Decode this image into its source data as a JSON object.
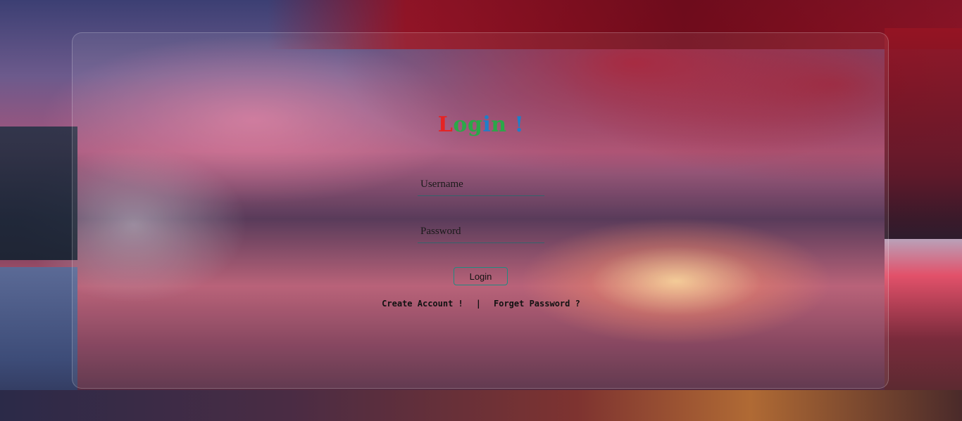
{
  "title": {
    "letters": [
      {
        "char": "L",
        "color": "#e52424"
      },
      {
        "char": "o",
        "color": "#2aa848"
      },
      {
        "char": "g",
        "color": "#2aa848"
      },
      {
        "char": "i",
        "color": "#1e7fc9"
      },
      {
        "char": "n",
        "color": "#2aa848"
      },
      {
        "char": " ",
        "color": "#2aa848"
      },
      {
        "char": "!",
        "color": "#1e7fc9"
      }
    ]
  },
  "form": {
    "username_placeholder": "Username",
    "password_placeholder": "Password",
    "login_label": "Login"
  },
  "links": {
    "create_account": "Create Account !",
    "separator": "|",
    "forget_password": "Forget Password ?"
  }
}
